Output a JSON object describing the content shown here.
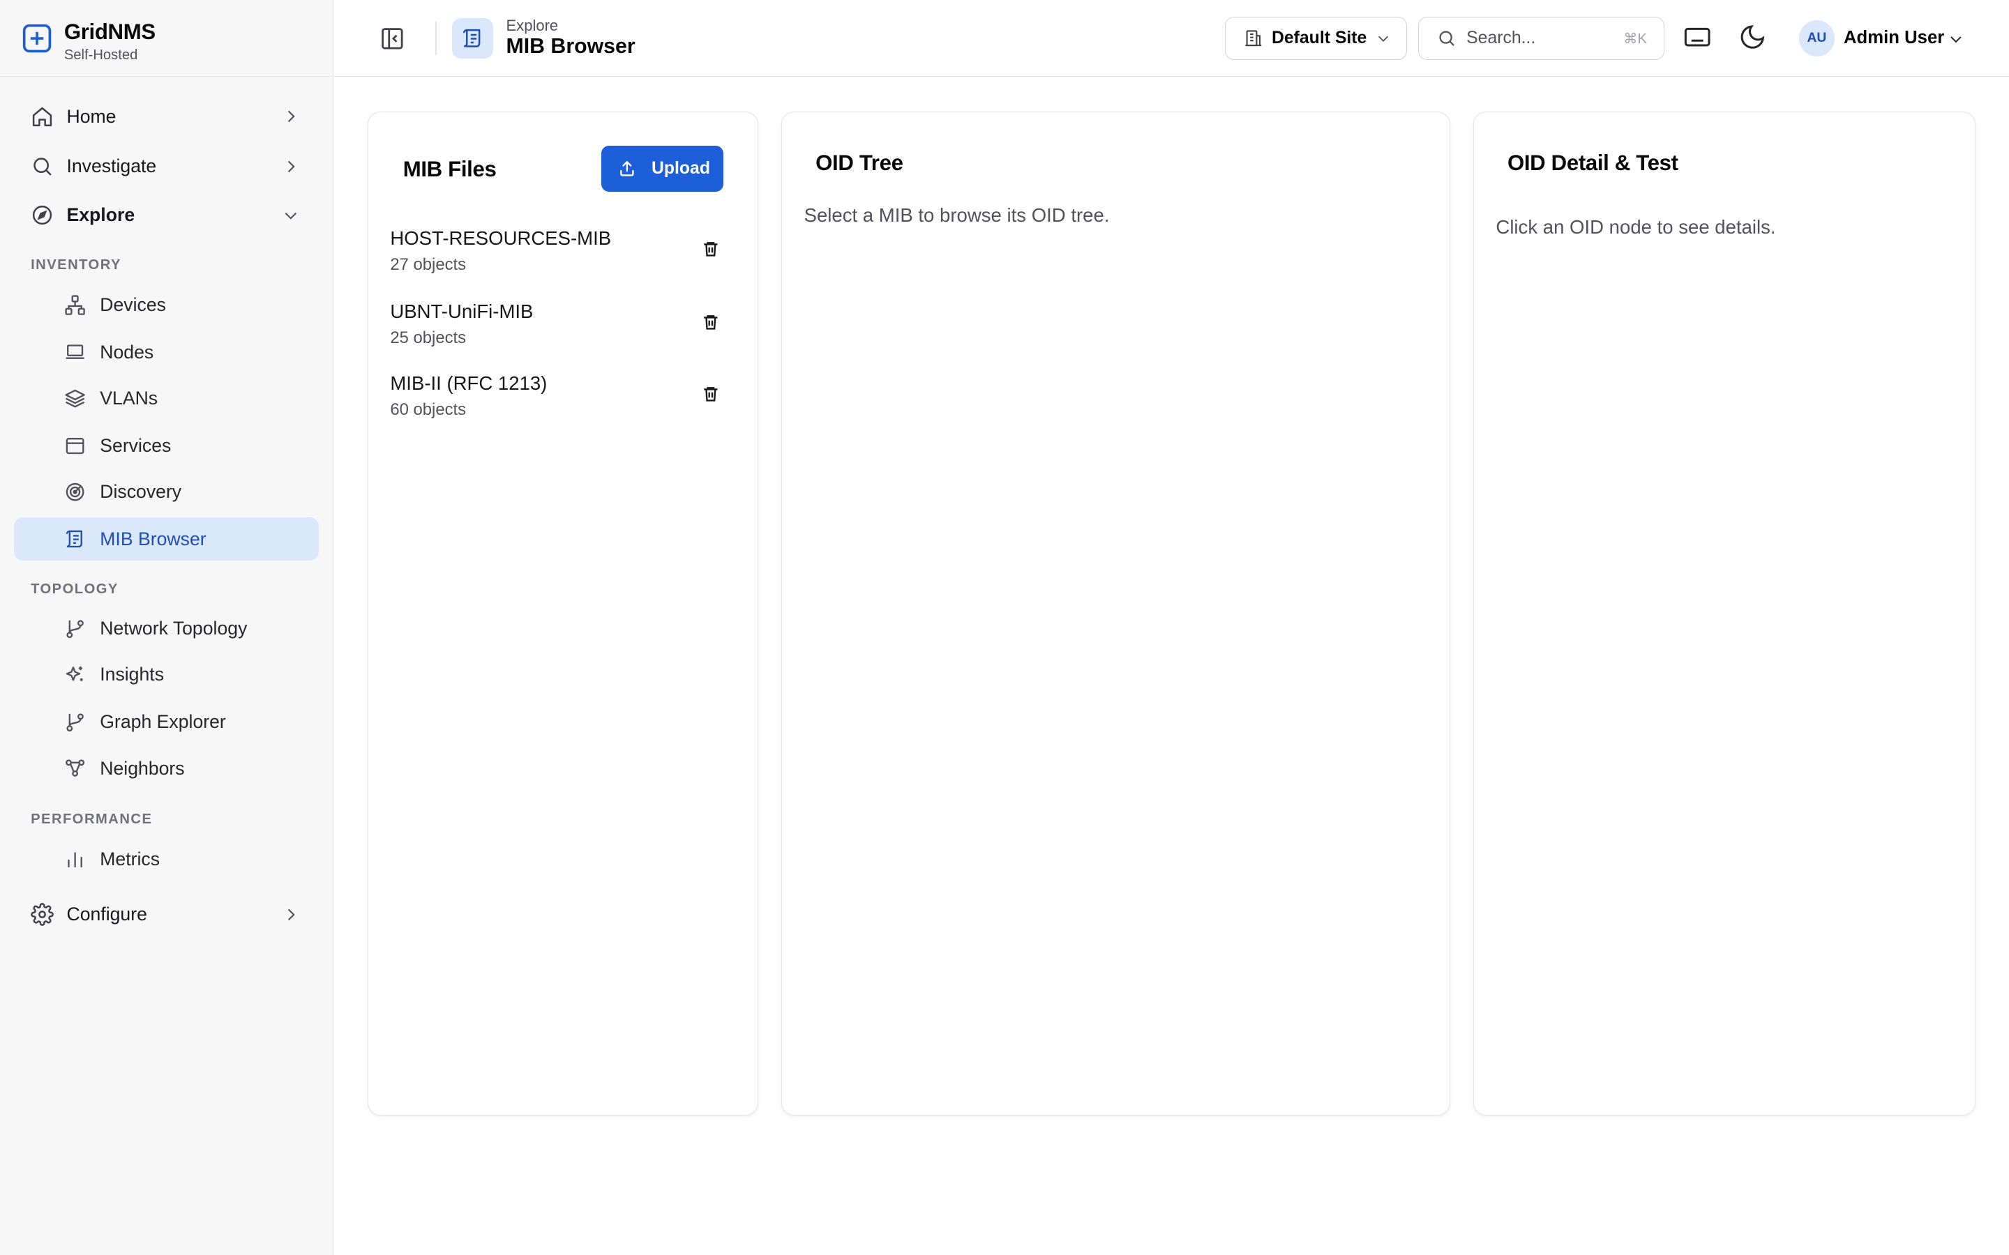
{
  "brand": {
    "name": "GridNMS",
    "subtitle": "Self-Hosted"
  },
  "sidebar": {
    "home": "Home",
    "investigate": "Investigate",
    "explore": "Explore",
    "configure": "Configure",
    "sections": {
      "inventory": "INVENTORY",
      "topology": "TOPOLOGY",
      "performance": "PERFORMANCE"
    },
    "inventory_items": [
      "Devices",
      "Nodes",
      "VLANs",
      "Services",
      "Discovery",
      "MIB Browser"
    ],
    "topology_items": [
      "Network Topology",
      "Insights",
      "Graph Explorer",
      "Neighbors"
    ],
    "performance_items": [
      "Metrics"
    ],
    "active": "MIB Browser"
  },
  "header": {
    "breadcrumb_parent": "Explore",
    "page_title": "MIB Browser",
    "site_label": "Default Site",
    "search_placeholder": "Search...",
    "search_shortcut": "⌘K",
    "user_initials": "AU",
    "user_name": "Admin User"
  },
  "mib_files": {
    "title": "MIB Files",
    "upload_label": "Upload",
    "items": [
      {
        "name": "HOST-RESOURCES-MIB",
        "count": "27 objects"
      },
      {
        "name": "UBNT-UniFi-MIB",
        "count": "25 objects"
      },
      {
        "name": "MIB-II (RFC 1213)",
        "count": "60 objects"
      }
    ]
  },
  "oid_tree": {
    "title": "OID Tree",
    "empty": "Select a MIB to browse its OID tree."
  },
  "oid_detail": {
    "title": "OID Detail & Test",
    "empty": "Click an OID node to see details."
  },
  "colors": {
    "accent": "#1d5fd9",
    "active_bg": "#dbe8fb",
    "active_text": "#1e4fb3",
    "sidebar_bg": "#f7f7f8"
  },
  "icons": {
    "brand": "plus-square-icon",
    "home": "home-icon",
    "investigate": "search-icon",
    "explore": "compass-icon",
    "configure": "gear-icon",
    "devices": "network-icon",
    "nodes": "laptop-icon",
    "vlans": "layers-icon",
    "services": "browser-window-icon",
    "discovery": "radar-icon",
    "mib_browser": "scroll-icon",
    "network_topology": "git-branch-icon",
    "insights": "sparkles-icon",
    "graph_explorer": "git-branch-icon",
    "neighbors": "share-nodes-icon",
    "metrics": "bar-chart-icon"
  }
}
